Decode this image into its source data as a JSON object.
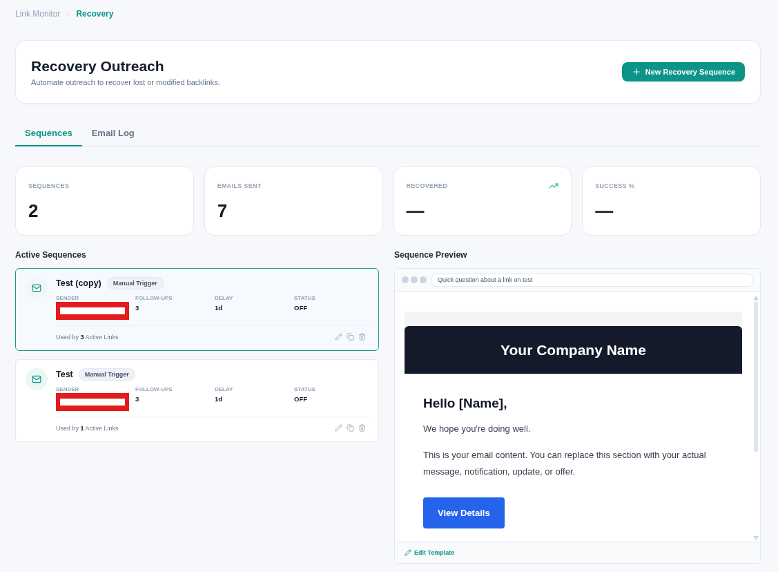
{
  "breadcrumb": [
    {
      "label": "Link Monitor",
      "selected": false
    },
    {
      "label": "Recovery",
      "selected": true
    }
  ],
  "header": {
    "title": "Recovery Outreach",
    "subtitle": "Automate outreach to recover lost or modified backlinks.",
    "action": "New Recovery Sequence"
  },
  "tabs": [
    {
      "label": "Sequences",
      "selected": true
    },
    {
      "label": "Email Log",
      "selected": false
    }
  ],
  "stats": [
    {
      "label": "SEQUENCES",
      "value": "2",
      "kind": "plain"
    },
    {
      "label": "EMAILS SENT",
      "value": "7",
      "kind": "plain"
    },
    {
      "label": "RECOVERED",
      "value": "—",
      "kind": "trend"
    },
    {
      "label": "SUCCESS %",
      "value": "—",
      "kind": "plain"
    }
  ],
  "active_sequences": {
    "title": "Active Sequences",
    "items": [
      {
        "name": "Test (copy)",
        "badge": "Manual Trigger",
        "selected": true,
        "fields": [
          {
            "label": "SENDER",
            "redacted": true
          },
          {
            "label": "FOLLOW-UPS",
            "value": "3"
          },
          {
            "label": "DELAY",
            "value": "1d"
          },
          {
            "label": "STATUS",
            "value": "OFF"
          }
        ],
        "usage": "Used by **3** Active Links"
      },
      {
        "name": "Test",
        "badge": "Manual Trigger",
        "selected": false,
        "fields": [
          {
            "label": "SENDER",
            "redacted": true
          },
          {
            "label": "FOLLOW-UPS",
            "value": "3"
          },
          {
            "label": "DELAY",
            "value": "1d"
          },
          {
            "label": "STATUS",
            "value": "OFF"
          }
        ],
        "usage": "Used by **1** Active Links"
      }
    ]
  },
  "preview": {
    "title": "Sequence Preview",
    "subject": "Quick question about a link on test",
    "company": "Your Company Name",
    "greeting": "Hello [Name],",
    "paragraphs": [
      "We hope you're doing well.",
      "This is your email content. You can replace this section with your actual message, notification, update, or offer."
    ],
    "button": "View Details",
    "edit": "Edit Template"
  }
}
